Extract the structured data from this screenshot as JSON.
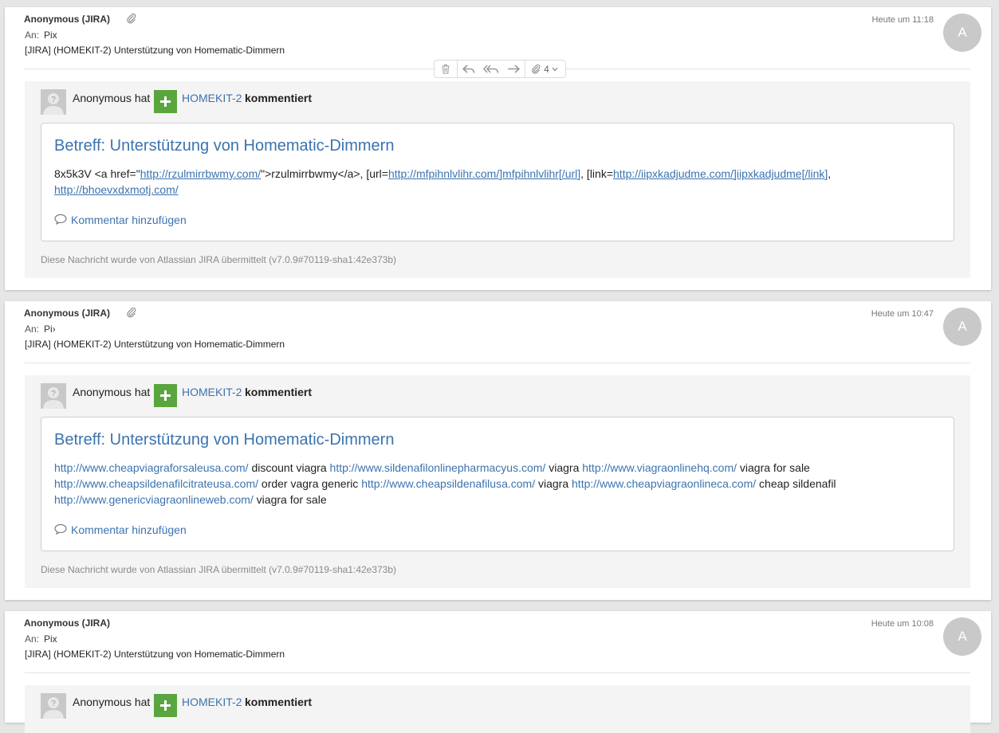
{
  "messages": [
    {
      "sender": "Anonymous (JIRA)",
      "to_label": "An:",
      "to": "Pix",
      "subject": "[JIRA] (HOMEKIT-2) Unterstützung von Homematic-Dimmern",
      "time": "Heute um 11:18",
      "avatar_letter": "A",
      "has_attachment": true,
      "toolbar": {
        "attachment_count": "4"
      },
      "actor": "Anonymous hat",
      "issue_key": "HOMEKIT-2",
      "action": "kommentiert",
      "card_title": "Betreff: Unterstützung von Homematic-Dimmern",
      "body": [
        {
          "text": "8x5k3V <a href=\""
        },
        {
          "link": "http://rzulmirrbwmy.com/"
        },
        {
          "text": "\">rzulmirrbwmy</a>, [url="
        },
        {
          "link": "http://mfpihnlvlihr.com/]mfpihnlvlihr[/url]"
        },
        {
          "text": ", [link="
        },
        {
          "link": "http://iipxkadjudme.com/]iipxkadjudme[/link]"
        },
        {
          "text": ", "
        },
        {
          "br": true
        },
        {
          "link": "http://bhoevxdxmotj.com/"
        }
      ],
      "add_comment": "Kommentar hinzufügen",
      "footer": "Diese Nachricht wurde von Atlassian JIRA übermittelt (v7.0.9#70119-sha1:42e373b)"
    },
    {
      "sender": "Anonymous (JIRA)",
      "to_label": "An:",
      "to": "Pi›",
      "subject": "[JIRA] (HOMEKIT-2) Unterstützung von Homematic-Dimmern",
      "time": "Heute um 10:47",
      "avatar_letter": "A",
      "has_attachment": true,
      "actor": "Anonymous hat",
      "issue_key": "HOMEKIT-2",
      "action": "kommentiert",
      "card_title": "Betreff: Unterstützung von Homematic-Dimmern",
      "body": [
        {
          "plainlink": "http://www.cheapviagraforsaleusa.com/"
        },
        {
          "text": " discount viagra "
        },
        {
          "plainlink": "http://www.sildenafilonlinepharmacyus.com/"
        },
        {
          "text": " viagra "
        },
        {
          "plainlink": "http://www.viagraonlinehq.com/"
        },
        {
          "text": " viagra for sale "
        },
        {
          "br": true
        },
        {
          "plainlink": "http://www.cheapsildenafilcitrateusa.com/"
        },
        {
          "text": " order vagra generic "
        },
        {
          "plainlink": "http://www.cheapsildenafilusa.com/"
        },
        {
          "text": " viagra "
        },
        {
          "plainlink": "http://www.cheapviagraonlineca.com/"
        },
        {
          "text": " cheap sildenafil "
        },
        {
          "br": true
        },
        {
          "plainlink": "http://www.genericviagraonlineweb.com/"
        },
        {
          "text": " viagra for sale"
        }
      ],
      "add_comment": "Kommentar hinzufügen",
      "footer": "Diese Nachricht wurde von Atlassian JIRA übermittelt (v7.0.9#70119-sha1:42e373b)"
    },
    {
      "sender": "Anonymous (JIRA)",
      "to_label": "An:",
      "to": "Pix",
      "subject": "[JIRA] (HOMEKIT-2) Unterstützung von Homematic-Dimmern",
      "time": "Heute um 10:08",
      "avatar_letter": "A",
      "has_attachment": false,
      "actor": "Anonymous hat",
      "issue_key": "HOMEKIT-2",
      "action": "kommentiert"
    }
  ],
  "colors": {
    "link": "#3b73af",
    "plus_icon": "#59a53e",
    "avatar": "#c9c9c9",
    "panel": "#f4f4f4"
  },
  "icons": {
    "attachment": "paperclip-icon",
    "trash": "trash-icon",
    "reply": "reply-icon",
    "reply_all": "reply-all-icon",
    "forward": "forward-icon",
    "comment": "speech-bubble-icon",
    "user": "default-user-avatar-icon",
    "comment_type": "plus-icon"
  }
}
